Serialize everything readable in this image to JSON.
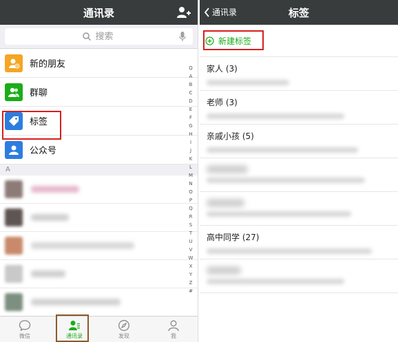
{
  "left": {
    "header": {
      "title": "通讯录"
    },
    "search": {
      "placeholder": "搜索"
    },
    "menu": [
      {
        "label": "新的朋友",
        "color": "#f5a623",
        "icon": "add-friend-icon"
      },
      {
        "label": "群聊",
        "color": "#1aad19",
        "icon": "group-icon"
      },
      {
        "label": "标签",
        "color": "#2d7de0",
        "icon": "tag-icon"
      },
      {
        "label": "公众号",
        "color": "#2d7de0",
        "icon": "official-account-icon"
      }
    ],
    "section": "A",
    "index_letters": [
      "Q",
      "A",
      "B",
      "C",
      "D",
      "E",
      "F",
      "G",
      "H",
      "I",
      "J",
      "K",
      "L",
      "M",
      "N",
      "O",
      "P",
      "Q",
      "R",
      "S",
      "T",
      "U",
      "V",
      "W",
      "X",
      "Y",
      "Z",
      "#"
    ],
    "tabs": [
      {
        "label": "微信",
        "icon": "chat-bubble-icon"
      },
      {
        "label": "通讯录",
        "icon": "contacts-icon"
      },
      {
        "label": "发现",
        "icon": "compass-icon"
      },
      {
        "label": "我",
        "icon": "person-icon"
      }
    ]
  },
  "right": {
    "header": {
      "title": "标签",
      "back_label": "通讯录"
    },
    "new_tag": "新建标签",
    "tags": [
      {
        "title": "家人 (3)"
      },
      {
        "title": "老师 (3)"
      },
      {
        "title": "亲戚小孩 (5)"
      },
      {
        "title": ""
      },
      {
        "title": ""
      },
      {
        "title": "高中同学 (27)"
      },
      {
        "title": ""
      }
    ]
  },
  "colors": {
    "accent": "#1aad19",
    "highlight": "#d71e1e",
    "navbar": "#383c3d"
  }
}
